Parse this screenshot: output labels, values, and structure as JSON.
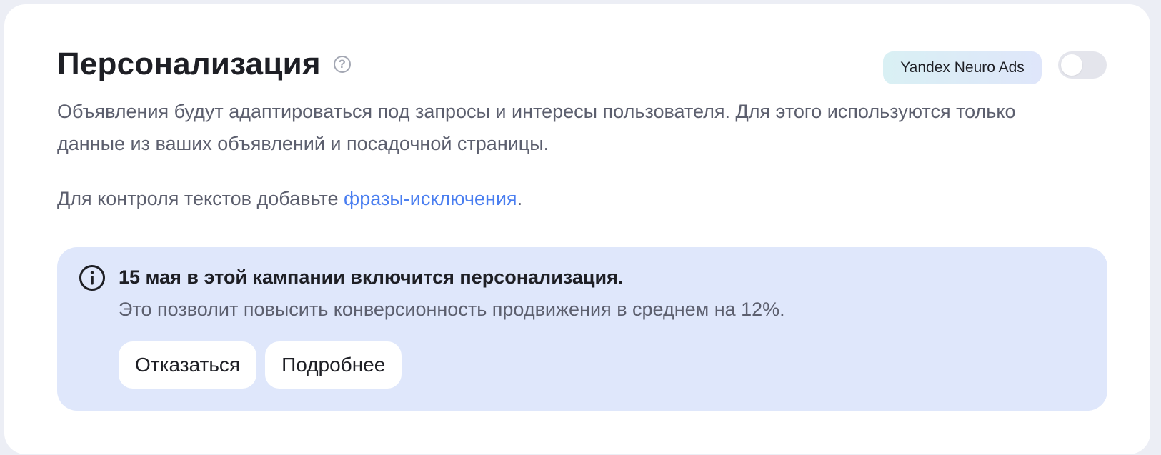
{
  "section": {
    "title": "Персонализация",
    "help_icon": "question-circle-icon",
    "badge_label": "Yandex Neuro Ads",
    "toggle_state": "off"
  },
  "description": "Объявления будут адаптироваться под запросы и интересы пользователя. Для этого используются только данные из ваших объявлений и посадочной страницы.",
  "exclusions": {
    "prefix": "Для контроля текстов добавьте ",
    "link_label": "фразы-исключения",
    "suffix": "."
  },
  "notice": {
    "icon": "info-circle-icon",
    "title": "15 мая в этой кампании включится персонализация.",
    "text": "Это позволит повысить конверсионность продвижения в среднем на 12%.",
    "decline_label": "Отказаться",
    "more_label": "Подробнее"
  },
  "colors": {
    "page_bg": "#eceef5",
    "card_bg": "#ffffff",
    "notice_bg": "#dfe7fb",
    "link": "#4a7ef0",
    "toggle_off": "#e4e5ec"
  }
}
